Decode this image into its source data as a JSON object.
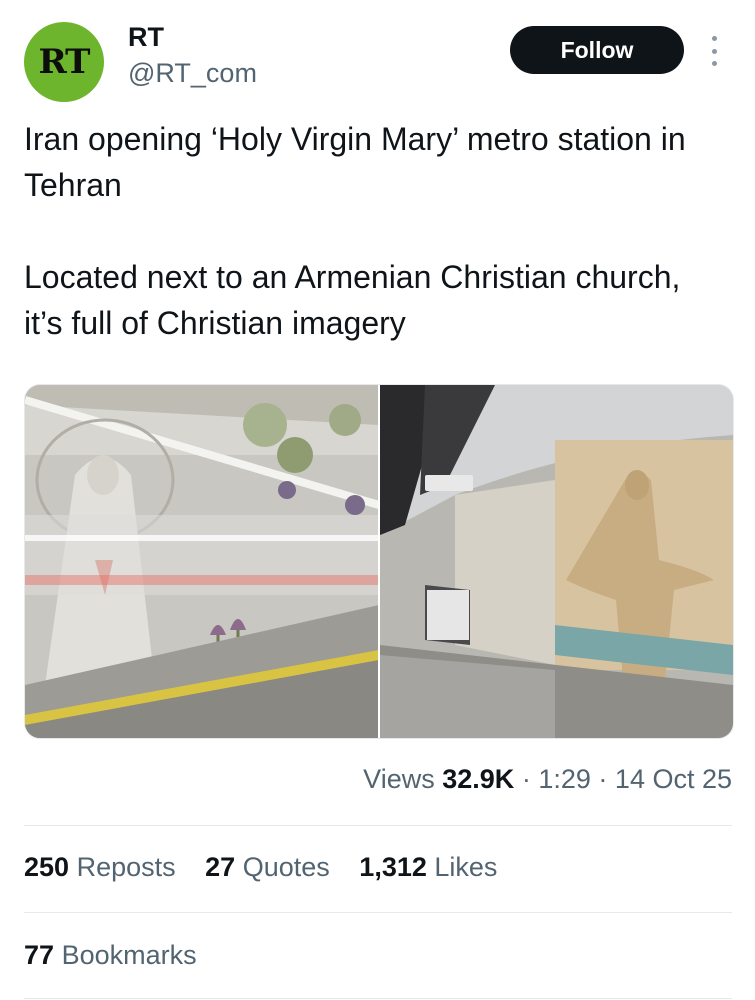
{
  "author": {
    "avatar_text": "RT",
    "name": "RT",
    "handle": "@RT_com",
    "brand_color": "#6cb52d"
  },
  "follow_label": "Follow",
  "more_icon": "more-options-icon",
  "tweet": {
    "paragraph_1": "Iran opening ‘Holy Virgin Mary’ metro station in Tehran",
    "paragraph_2": "Located next to an Armenian Christian church, it’s full of Christian imagery"
  },
  "media": {
    "panels": [
      "virgin-mary-relief-platform-photo",
      "jesus-relief-escalator-photo"
    ]
  },
  "meta": {
    "views_label": "Views",
    "views_count": "32.9K",
    "sep": "·",
    "time": "1:29",
    "date": "14 Oct 25"
  },
  "stats": {
    "reposts_count": "250",
    "reposts_label": "Reposts",
    "quotes_count": "27",
    "quotes_label": "Quotes",
    "likes_count": "1,312",
    "likes_label": "Likes",
    "bookmarks_count": "77",
    "bookmarks_label": "Bookmarks"
  }
}
